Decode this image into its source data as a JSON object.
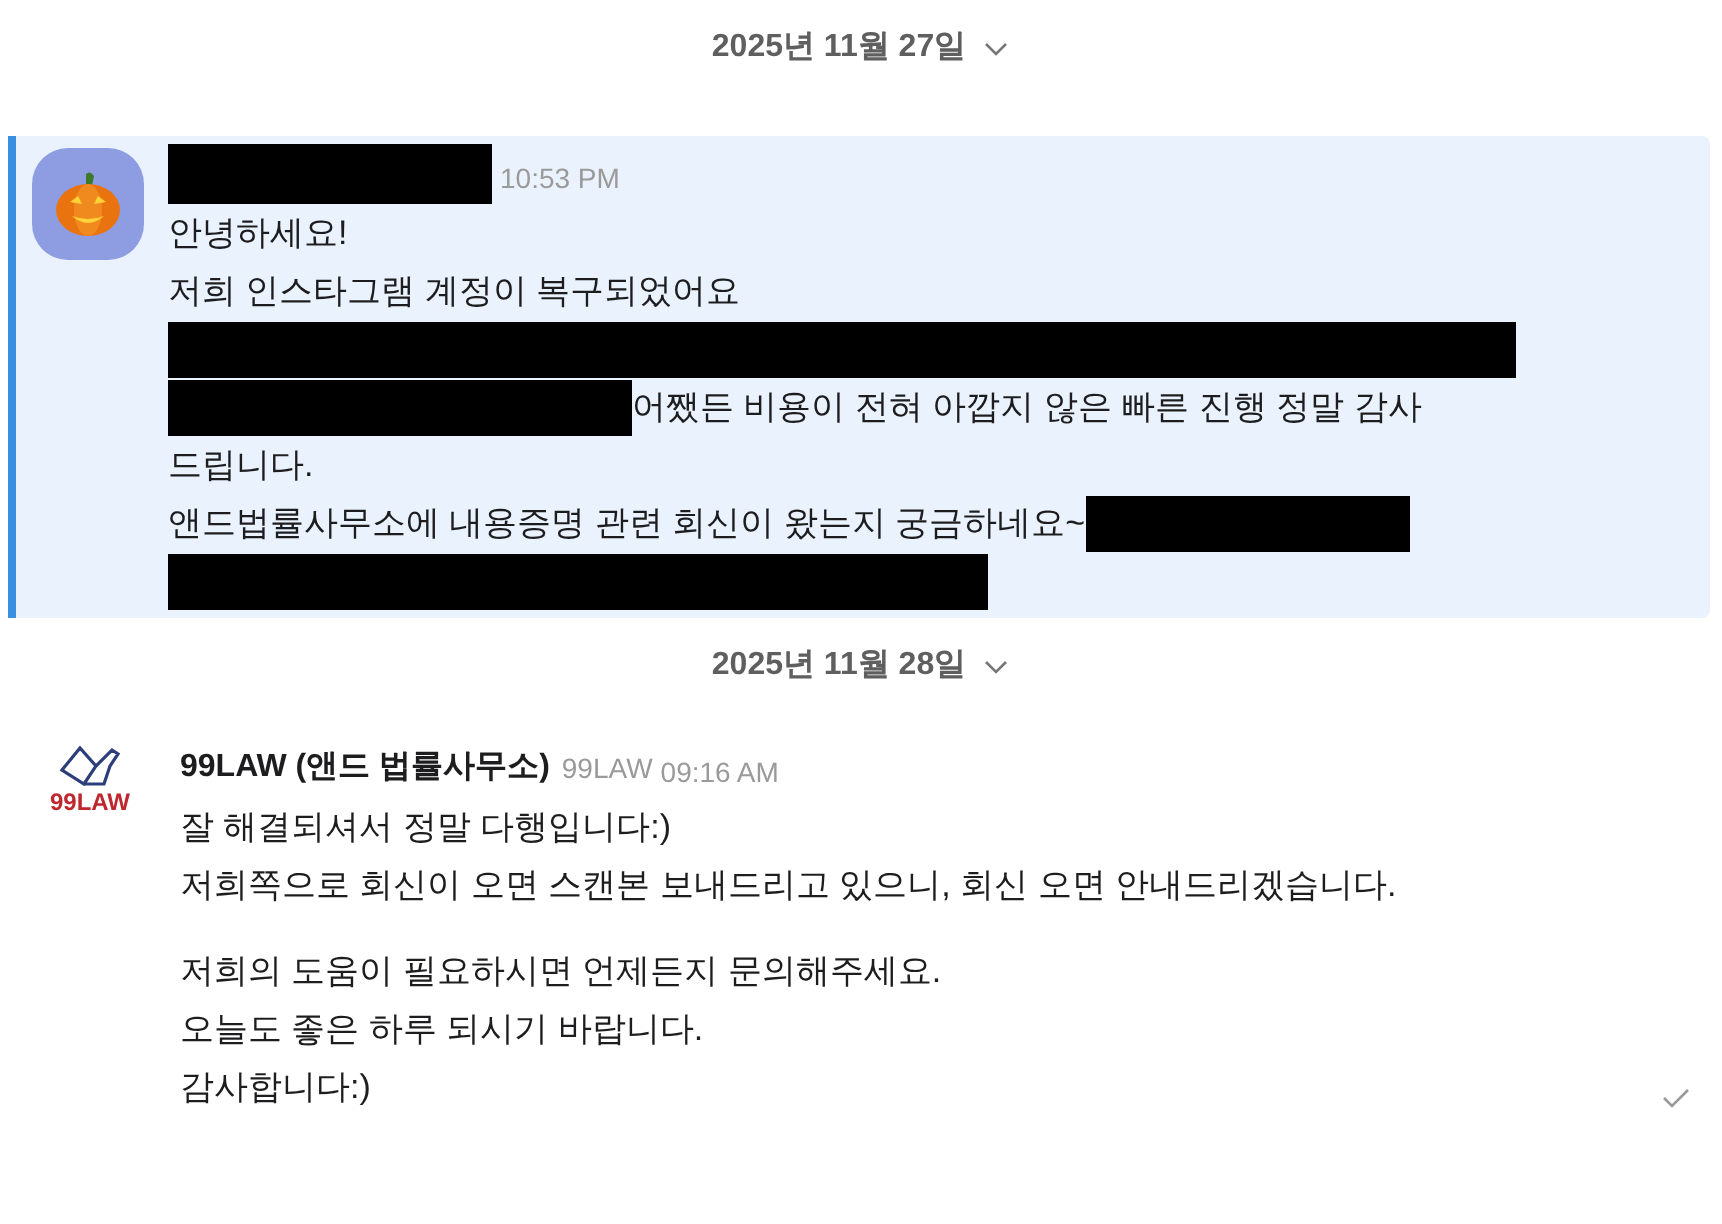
{
  "messages": [
    {
      "date": "2025년 11월 27일",
      "highlighted": true,
      "avatar": {
        "kind": "pumpkin"
      },
      "sender": {
        "redacted": true
      },
      "time": "10:53 PM",
      "paragraphs": [
        [
          [
            {
              "kind": "text",
              "text": "안녕하세요!"
            }
          ],
          [
            {
              "kind": "text",
              "text": "저희 인스타그램 계정이 복구되었어요"
            }
          ],
          [
            {
              "kind": "redactedline"
            }
          ],
          [
            {
              "kind": "redactedshort"
            },
            {
              "kind": "text",
              "text": "어쨌든 비용이 전혀 아깝지 않은 빠른 진행 정말 감사"
            }
          ],
          [
            {
              "kind": "text",
              "text": "드립니다."
            }
          ],
          [
            {
              "kind": "text",
              "text": "앤드법률사무소에 내용증명 관련 회신이 왔는지 궁금하네요~"
            },
            {
              "kind": "redactedtail"
            }
          ],
          [
            {
              "kind": "redactedhalf"
            }
          ]
        ]
      ],
      "read": false
    },
    {
      "date": "2025년 11월 28일",
      "highlighted": false,
      "avatar": {
        "kind": "logo"
      },
      "logo_text": "99LAW",
      "sender": {
        "redacted": false,
        "name": "99LAW (앤드 법률사무소)",
        "handle": "99LAW"
      },
      "time": "09:16 AM",
      "paragraphs": [
        [
          [
            {
              "kind": "text",
              "text": "잘 해결되셔서 정말 다행입니다:)"
            }
          ],
          [
            {
              "kind": "text",
              "text": "저희쪽으로 회신이 오면 스캔본 보내드리고 있으니, 회신 오면 안내드리겠습니다."
            }
          ]
        ],
        [
          [
            {
              "kind": "text",
              "text": "저희의 도움이 필요하시면 언제든지 문의해주세요."
            }
          ],
          [
            {
              "kind": "text",
              "text": "오늘도 좋은 하루 되시기 바랍니다."
            }
          ],
          [
            {
              "kind": "text",
              "text": "감사합니다:)"
            }
          ]
        ]
      ],
      "read": true
    }
  ]
}
